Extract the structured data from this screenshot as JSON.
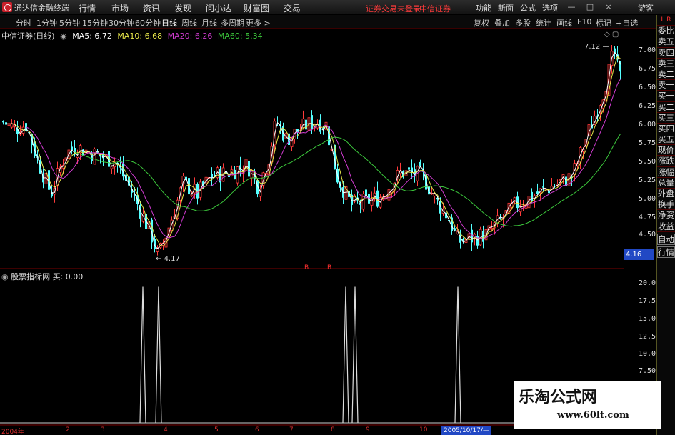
{
  "app": {
    "title": "通达信金融终端"
  },
  "menu": [
    "行情",
    "市场",
    "资讯",
    "发现",
    "问小达",
    "财富圈",
    "交易"
  ],
  "notices": [
    "证券交易未登录",
    "中信证券"
  ],
  "menu_right": [
    "功能",
    "新面",
    "公式",
    "选项"
  ],
  "guest_label": "游客",
  "periods": [
    "分时",
    "1分钟",
    "5分钟",
    "15分钟",
    "30分钟",
    "60分钟",
    "日线",
    "周线",
    "月线",
    "多周期",
    "更多 >"
  ],
  "active_period": "日线",
  "tools_right": [
    "复权",
    "叠加",
    "多股",
    "统计",
    "画线",
    "F10",
    "标记",
    "+自选"
  ],
  "legend": {
    "stock": "中信证券(日线)",
    "ma5": "MA5: 6.72",
    "ma10": "MA10: 6.68",
    "ma20": "MA20: 6.26",
    "ma60": "MA60: 5.34"
  },
  "indicator_legend": {
    "name": "股票指标网",
    "value": "买: 0.00"
  },
  "price_axis": [
    "7.00",
    "6.75",
    "6.50",
    "6.25",
    "6.00",
    "5.75",
    "5.50",
    "5.25",
    "5.00",
    "4.75",
    "4.50"
  ],
  "indicator_axis": [
    "20.00",
    "17.50",
    "15.00",
    "12.50",
    "10.00",
    "7.50"
  ],
  "current_price": "4.16",
  "high_label": "7.12",
  "low_label": "4.17",
  "x_axis": [
    "2004年",
    "2",
    "3",
    "4",
    "5",
    "6",
    "7",
    "8",
    "9",
    "10"
  ],
  "cursor_date": "2005/10/17/—",
  "signal_marker": "B",
  "sidebar": {
    "top": "L R",
    "items": [
      "委比",
      "卖五",
      "卖四",
      "卖三",
      "卖二",
      "卖一",
      "买一",
      "买二",
      "买三",
      "买四",
      "买五",
      "现价",
      "涨跌",
      "涨幅",
      "总量",
      "外盘",
      "换手",
      "净资",
      "收益"
    ],
    "tabs": [
      "自动",
      "行情"
    ]
  },
  "watermark": {
    "title": "乐淘公式网",
    "url": "www.60lt.com"
  },
  "colors": {
    "up": "#ff3b3b",
    "down": "#54ffff",
    "ma5": "#ffffff",
    "ma10": "#e8e84a",
    "ma20": "#d23cd2",
    "ma60": "#3cc83c"
  },
  "chart_data": [
    {
      "type": "candlestick",
      "title": "中信证券(日线)",
      "ylim": [
        4.17,
        7.12
      ],
      "series": [
        {
          "name": "MA5",
          "value": 6.72
        },
        {
          "name": "MA10",
          "value": 6.68
        },
        {
          "name": "MA20",
          "value": 6.26
        },
        {
          "name": "MA60",
          "value": 5.34
        }
      ]
    },
    {
      "type": "line",
      "title": "股票指标网",
      "ylim": [
        0,
        21
      ],
      "values": [
        20,
        20,
        20,
        20,
        20
      ]
    }
  ]
}
